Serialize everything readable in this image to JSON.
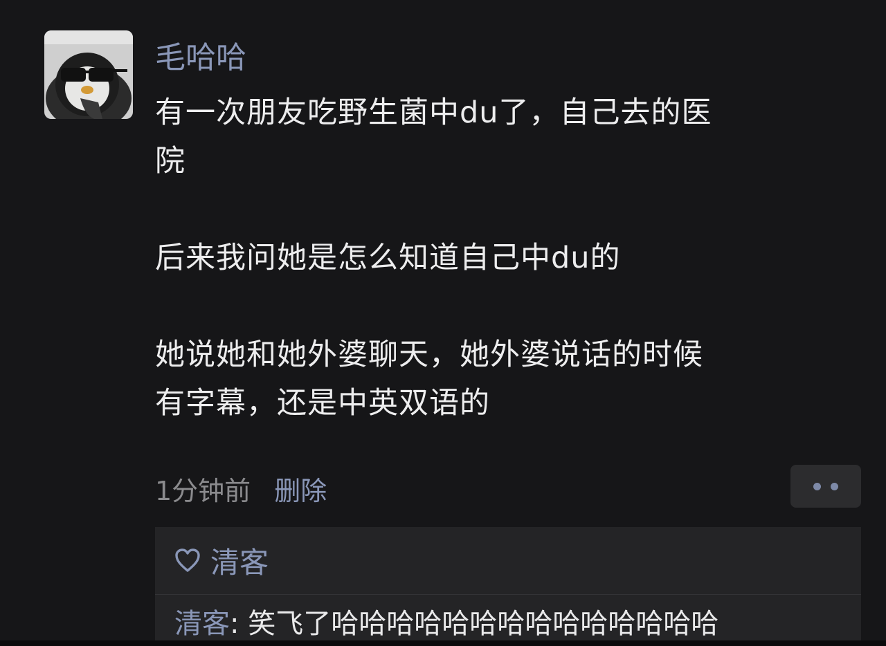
{
  "post": {
    "author": "毛哈哈",
    "lines": [
      "有一次朋友吃野生菌中du了，自己去的医",
      "院",
      "后来我问她是怎么知道自己中du的",
      "她说她和她外婆聊天，她外婆说话的时候",
      "有字幕，还是中英双语的"
    ],
    "time": "1分钟前",
    "delete_label": "删除",
    "more_icon": "more-dots-icon"
  },
  "likes": {
    "icon": "heart-outline-icon",
    "names": "清客"
  },
  "comment": {
    "commenter": "清客",
    "separator": ": ",
    "text": "笑飞了哈哈哈哈哈哈哈哈哈哈哈哈哈哈"
  },
  "colors": {
    "background": "#161618",
    "link": "#8a97b8",
    "text": "#ededee",
    "muted": "#8b8b8e",
    "panel": "#242426"
  }
}
